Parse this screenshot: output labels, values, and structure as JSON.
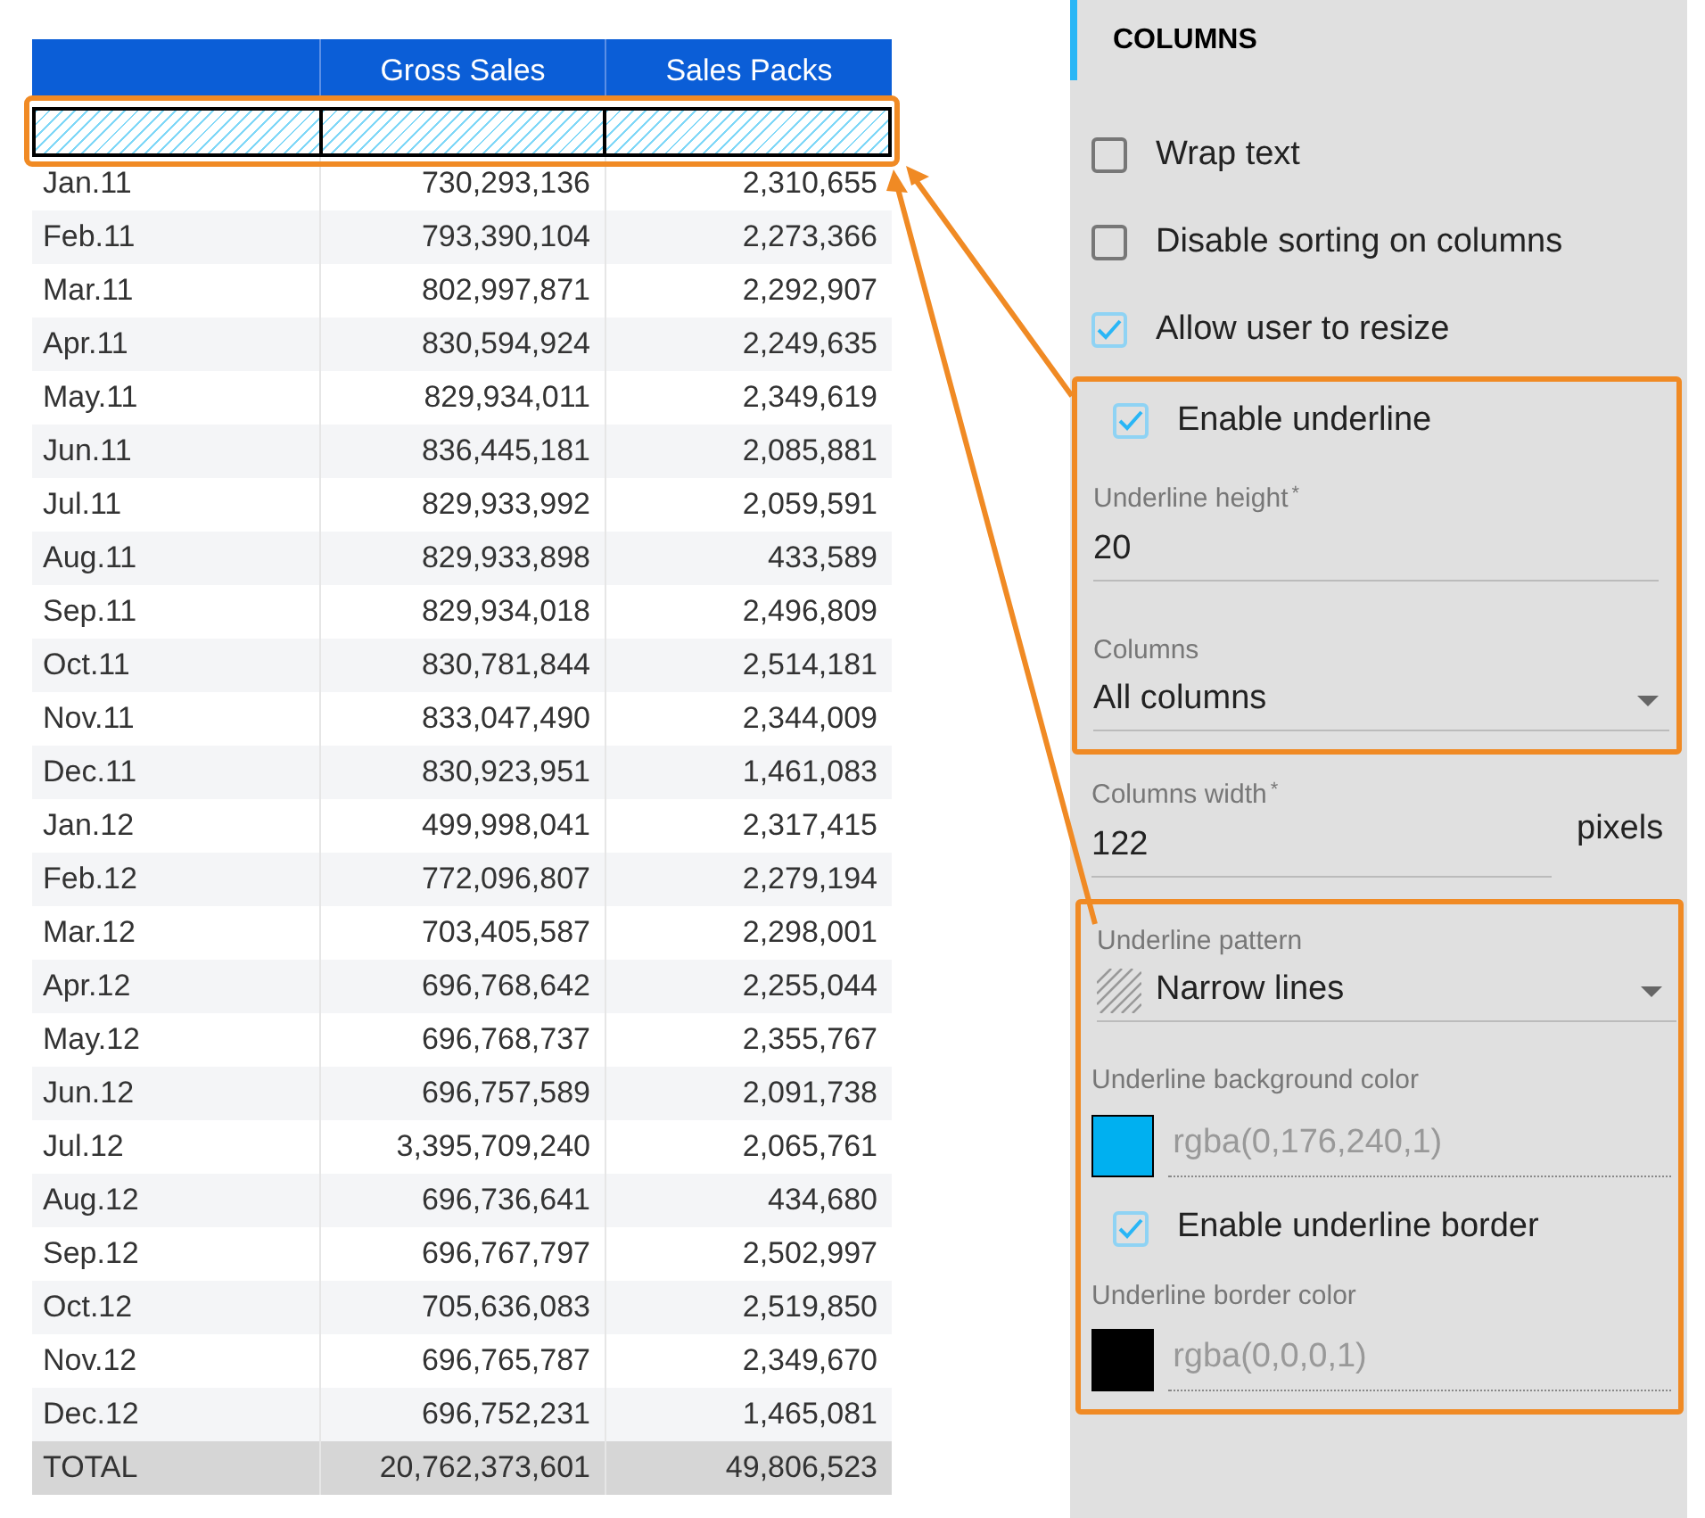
{
  "table": {
    "columns": [
      "",
      "Gross Sales",
      "Sales Packs"
    ],
    "rows": [
      [
        "Jan.11",
        "730,293,136",
        "2,310,655"
      ],
      [
        "Feb.11",
        "793,390,104",
        "2,273,366"
      ],
      [
        "Mar.11",
        "802,997,871",
        "2,292,907"
      ],
      [
        "Apr.11",
        "830,594,924",
        "2,249,635"
      ],
      [
        "May.11",
        "829,934,011",
        "2,349,619"
      ],
      [
        "Jun.11",
        "836,445,181",
        "2,085,881"
      ],
      [
        "Jul.11",
        "829,933,992",
        "2,059,591"
      ],
      [
        "Aug.11",
        "829,933,898",
        "433,589"
      ],
      [
        "Sep.11",
        "829,934,018",
        "2,496,809"
      ],
      [
        "Oct.11",
        "830,781,844",
        "2,514,181"
      ],
      [
        "Nov.11",
        "833,047,490",
        "2,344,009"
      ],
      [
        "Dec.11",
        "830,923,951",
        "1,461,083"
      ],
      [
        "Jan.12",
        "499,998,041",
        "2,317,415"
      ],
      [
        "Feb.12",
        "772,096,807",
        "2,279,194"
      ],
      [
        "Mar.12",
        "703,405,587",
        "2,298,001"
      ],
      [
        "Apr.12",
        "696,768,642",
        "2,255,044"
      ],
      [
        "May.12",
        "696,768,737",
        "2,355,767"
      ],
      [
        "Jun.12",
        "696,757,589",
        "2,091,738"
      ],
      [
        "Jul.12",
        "3,395,709,240",
        "2,065,761"
      ],
      [
        "Aug.12",
        "696,736,641",
        "434,680"
      ],
      [
        "Sep.12",
        "696,767,797",
        "2,502,997"
      ],
      [
        "Oct.12",
        "705,636,083",
        "2,519,850"
      ],
      [
        "Nov.12",
        "696,765,787",
        "2,349,670"
      ],
      [
        "Dec.12",
        "696,752,231",
        "1,465,081"
      ]
    ],
    "total": [
      "TOTAL",
      "20,762,373,601",
      "49,806,523"
    ]
  },
  "panel": {
    "title": "COLUMNS",
    "checkboxes": [
      {
        "label": "Wrap text",
        "checked": false
      },
      {
        "label": "Disable sorting on columns",
        "checked": false
      },
      {
        "label": "Allow user to resize",
        "checked": true
      }
    ],
    "underline_section": {
      "enable": {
        "label": "Enable underline",
        "checked": true
      },
      "height": {
        "label": "Underline height",
        "required_mark": "*",
        "value": "20"
      },
      "columns": {
        "label": "Columns",
        "value": "All columns"
      }
    },
    "columns_width": {
      "label": "Columns width",
      "required_mark": "*",
      "value": "122",
      "unit": "pixels"
    },
    "pattern_section": {
      "pattern": {
        "label": "Underline pattern",
        "value": "Narrow lines"
      },
      "background_color": {
        "label": "Underline background color",
        "value": "rgba(0,176,240,1)",
        "color": "#00b0f0"
      },
      "enable_border": {
        "label": "Enable underline border",
        "checked": true
      },
      "border_color": {
        "label": "Underline border color",
        "value": "rgba(0,0,0,1)",
        "color": "#000000"
      }
    }
  }
}
